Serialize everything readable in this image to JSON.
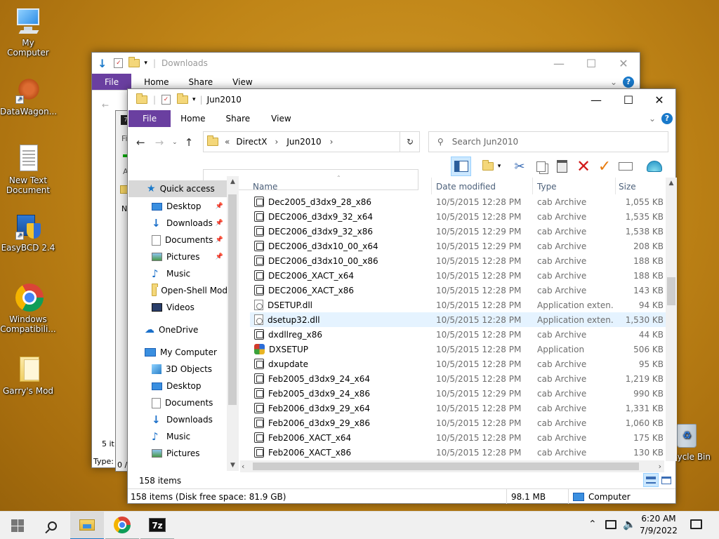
{
  "desktop": {
    "icons": [
      {
        "label": "My Computer"
      },
      {
        "label": "DataWagon..."
      },
      {
        "label": "New Text\nDocument"
      },
      {
        "label": "EasyBCD 2.4"
      },
      {
        "label": "Windows\nCompatibili..."
      },
      {
        "label": "Garry's Mod"
      },
      {
        "label": "cycle Bin"
      }
    ]
  },
  "back_window": {
    "title": "Downloads",
    "tabs": [
      "File",
      "Home",
      "Share",
      "View"
    ],
    "status_items": "5 it",
    "type_label": "Type:",
    "zero": "0 /",
    "fi": "Fi",
    "a": "A",
    "n": "N"
  },
  "window": {
    "title": "Jun2010",
    "tabs": [
      "File",
      "Home",
      "Share",
      "View"
    ],
    "breadcrumb": {
      "prefix": "«",
      "items": [
        "DirectX",
        "Jun2010"
      ]
    },
    "search_placeholder": "Search Jun2010",
    "columns": {
      "name": "Name",
      "date": "Date modified",
      "type": "Type",
      "size": "Size"
    },
    "nav": {
      "quick_access": "Quick access",
      "quick_items": [
        "Desktop",
        "Downloads",
        "Documents",
        "Pictures",
        "Music",
        "Open-Shell Mod",
        "Videos"
      ],
      "onedrive": "OneDrive",
      "my_computer": "My Computer",
      "computer_items": [
        "3D Objects",
        "Desktop",
        "Documents",
        "Downloads",
        "Music",
        "Pictures"
      ]
    },
    "files": [
      {
        "name": "Dec2005_d3dx9_28_x86",
        "date": "10/5/2015 12:28 PM",
        "type": "cab Archive",
        "size": "1,055 KB",
        "icon": "cab"
      },
      {
        "name": "DEC2006_d3dx9_32_x64",
        "date": "10/5/2015 12:28 PM",
        "type": "cab Archive",
        "size": "1,535 KB",
        "icon": "cab"
      },
      {
        "name": "DEC2006_d3dx9_32_x86",
        "date": "10/5/2015 12:29 PM",
        "type": "cab Archive",
        "size": "1,538 KB",
        "icon": "cab"
      },
      {
        "name": "DEC2006_d3dx10_00_x64",
        "date": "10/5/2015 12:29 PM",
        "type": "cab Archive",
        "size": "208 KB",
        "icon": "cab"
      },
      {
        "name": "DEC2006_d3dx10_00_x86",
        "date": "10/5/2015 12:28 PM",
        "type": "cab Archive",
        "size": "188 KB",
        "icon": "cab"
      },
      {
        "name": "DEC2006_XACT_x64",
        "date": "10/5/2015 12:28 PM",
        "type": "cab Archive",
        "size": "188 KB",
        "icon": "cab"
      },
      {
        "name": "DEC2006_XACT_x86",
        "date": "10/5/2015 12:28 PM",
        "type": "cab Archive",
        "size": "143 KB",
        "icon": "cab"
      },
      {
        "name": "DSETUP.dll",
        "date": "10/5/2015 12:28 PM",
        "type": "Application exten...",
        "size": "94 KB",
        "icon": "dll"
      },
      {
        "name": "dsetup32.dll",
        "date": "10/5/2015 12:28 PM",
        "type": "Application exten...",
        "size": "1,530 KB",
        "icon": "dll"
      },
      {
        "name": "dxdllreg_x86",
        "date": "10/5/2015 12:28 PM",
        "type": "cab Archive",
        "size": "44 KB",
        "icon": "cab"
      },
      {
        "name": "DXSETUP",
        "date": "10/5/2015 12:28 PM",
        "type": "Application",
        "size": "506 KB",
        "icon": "exe"
      },
      {
        "name": "dxupdate",
        "date": "10/5/2015 12:28 PM",
        "type": "cab Archive",
        "size": "95 KB",
        "icon": "cab"
      },
      {
        "name": "Feb2005_d3dx9_24_x64",
        "date": "10/5/2015 12:28 PM",
        "type": "cab Archive",
        "size": "1,219 KB",
        "icon": "cab"
      },
      {
        "name": "Feb2005_d3dx9_24_x86",
        "date": "10/5/2015 12:29 PM",
        "type": "cab Archive",
        "size": "990 KB",
        "icon": "cab"
      },
      {
        "name": "Feb2006_d3dx9_29_x64",
        "date": "10/5/2015 12:28 PM",
        "type": "cab Archive",
        "size": "1,331 KB",
        "icon": "cab"
      },
      {
        "name": "Feb2006_d3dx9_29_x86",
        "date": "10/5/2015 12:28 PM",
        "type": "cab Archive",
        "size": "1,060 KB",
        "icon": "cab"
      },
      {
        "name": "Feb2006_XACT_x64",
        "date": "10/5/2015 12:28 PM",
        "type": "cab Archive",
        "size": "175 KB",
        "icon": "cab"
      },
      {
        "name": "Feb2006_XACT_x86",
        "date": "10/5/2015 12:28 PM",
        "type": "cab Archive",
        "size": "130 KB",
        "icon": "cab"
      }
    ],
    "hovered_file_index": 8,
    "item_count": "158 items",
    "statusbar": {
      "left": "158 items (Disk free space: 81.9 GB)",
      "size": "98.1 MB",
      "location": "Computer"
    }
  },
  "taskbar": {
    "time": "6:20 AM",
    "date": "7/9/2022",
    "apps": [
      "file-explorer",
      "chrome",
      "7zip"
    ],
    "sevenzip_label": "7z"
  },
  "colors": {
    "accent": "#1979ca",
    "file_tab": "#1979ca",
    "hover": "#e5f3ff",
    "taskbar": "#f0f0f0"
  }
}
